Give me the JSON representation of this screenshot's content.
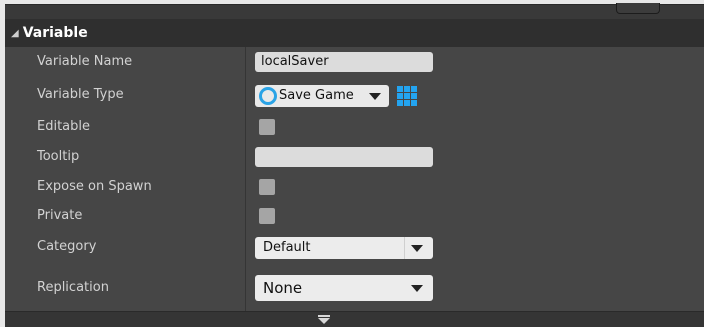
{
  "section": {
    "title": "Variable",
    "collapse_glyph": "◢"
  },
  "rows": {
    "variable_name": {
      "label": "Variable Name",
      "value": "localSaver"
    },
    "variable_type": {
      "label": "Variable Type",
      "value": "Save Game",
      "type_icon": "object-ring-icon",
      "container_icon": "grid-icon"
    },
    "editable": {
      "label": "Editable",
      "checked": false
    },
    "tooltip": {
      "label": "Tooltip",
      "value": ""
    },
    "expose_on_spawn": {
      "label": "Expose on Spawn",
      "checked": false
    },
    "private": {
      "label": "Private",
      "checked": false
    },
    "category": {
      "label": "Category",
      "value": "Default"
    },
    "replication": {
      "label": "Replication",
      "value": "None"
    }
  },
  "colors": {
    "panel_bg": "#464646",
    "header_bg": "#2f2f2f",
    "accent_blue": "#23a4f0"
  }
}
